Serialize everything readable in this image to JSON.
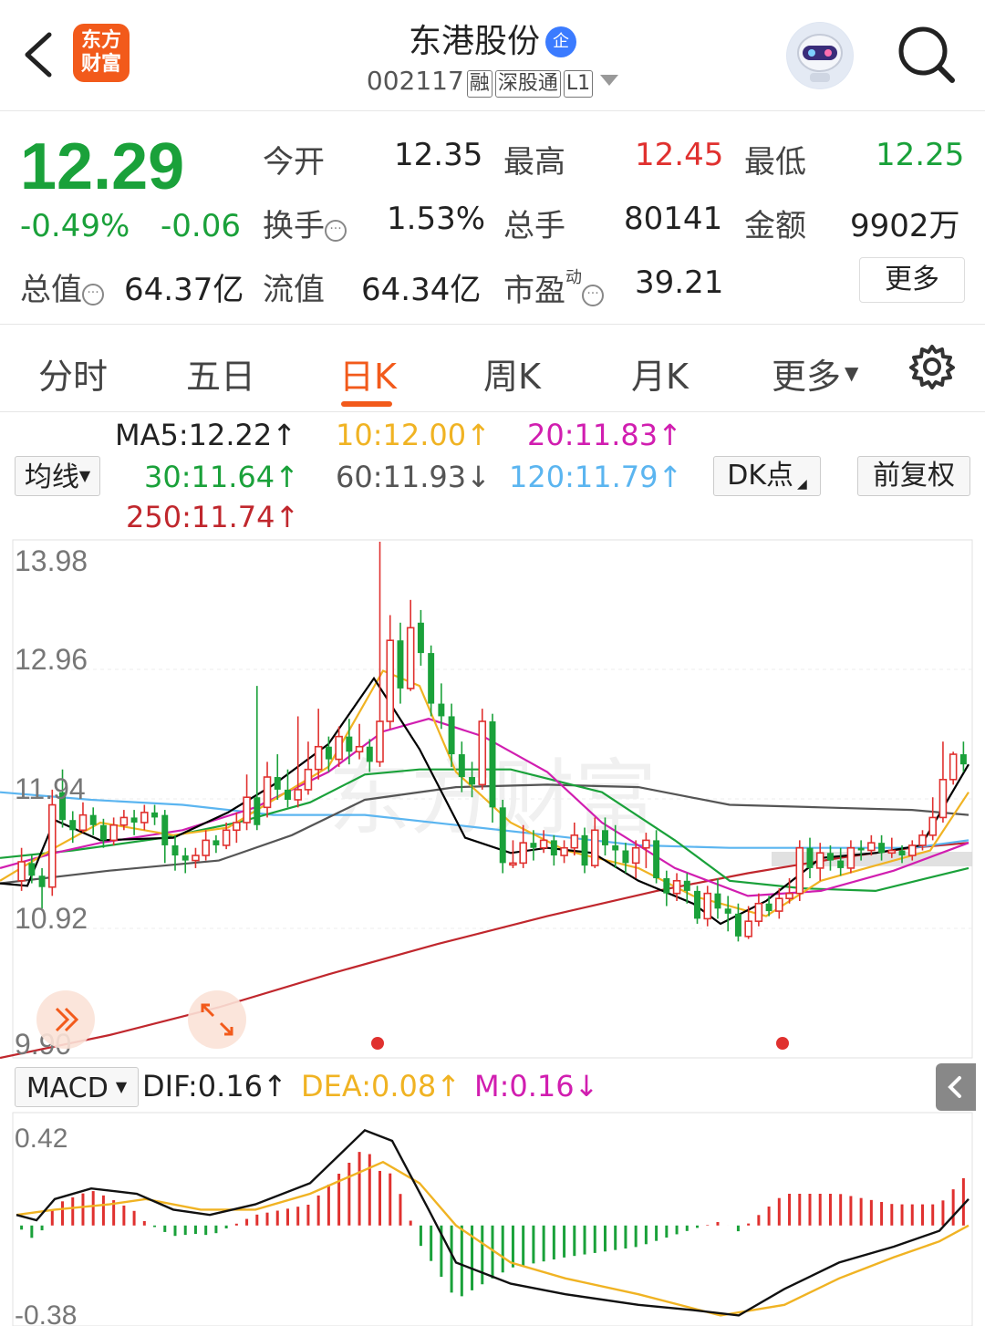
{
  "header": {
    "title": "东港股份",
    "qi_badge": "企",
    "code": "002117",
    "tags": [
      "融",
      "深股通",
      "L1"
    ],
    "logo_line1": "东方",
    "logo_line2": "财富"
  },
  "quote": {
    "price": "12.29",
    "change_pct": "-0.49%",
    "change": "-0.06",
    "open_label": "今开",
    "open": "12.35",
    "high_label": "最高",
    "high": "12.45",
    "low_label": "最低",
    "low": "12.25",
    "turnover_label": "换手",
    "turnover": "1.53%",
    "volume_label": "总手",
    "volume": "80141",
    "amount_label": "金额",
    "amount": "9902万",
    "mktcap_label": "总值",
    "mktcap": "64.37亿",
    "float_label": "流值",
    "float_cap": "64.34亿",
    "pe_label": "市盈",
    "pe_sup": "动",
    "pe": "39.21",
    "more": "更多"
  },
  "tabs": [
    "分时",
    "五日",
    "日K",
    "周K",
    "月K",
    "更多"
  ],
  "ma": {
    "selector": "均线",
    "ma5": "MA5:12.22↑",
    "ma10": "10:12.00↑",
    "ma20": "20:11.83↑",
    "ma30": "30:11.64↑",
    "ma60": "60:11.93↓",
    "ma120": "120:11.79↑",
    "ma250": "250:11.74↑",
    "dk": "DK点",
    "adjust": "前复权"
  },
  "macd": {
    "selector": "MACD",
    "dif": "DIF:0.16↑",
    "dea": "DEA:0.08↑",
    "m": "M:0.16↓",
    "axis_top": "0.42",
    "axis_bottom": "-0.38"
  },
  "chart_data": {
    "type": "candlestick",
    "y_axis_labels": [
      "13.98",
      "12.96",
      "11.94",
      "10.92",
      "9.90"
    ],
    "ylim": [
      9.9,
      13.98
    ],
    "colors": {
      "up": "#e0312f",
      "down": "#1aa13a",
      "ma5": "#000000",
      "ma10": "#f0b323",
      "ma20": "#d11eb0",
      "ma30": "#1aa13a",
      "ma60": "#555555",
      "ma120": "#5bb5f0",
      "ma250": "#c0272d"
    },
    "candles": [
      [
        11.3,
        11.45,
        11.56,
        11.22
      ],
      [
        11.44,
        11.34,
        11.5,
        11.28
      ],
      [
        11.34,
        11.25,
        11.4,
        11.08
      ],
      [
        11.25,
        11.9,
        12.02,
        11.18
      ],
      [
        12.0,
        11.78,
        12.18,
        11.72
      ],
      [
        11.78,
        11.7,
        11.85,
        11.6
      ],
      [
        11.7,
        11.82,
        11.92,
        11.68
      ],
      [
        11.82,
        11.74,
        11.88,
        11.66
      ],
      [
        11.74,
        11.62,
        11.79,
        11.56
      ],
      [
        11.62,
        11.74,
        11.8,
        11.58
      ],
      [
        11.74,
        11.8,
        11.86,
        11.7
      ],
      [
        11.8,
        11.76,
        11.86,
        11.66
      ],
      [
        11.76,
        11.84,
        11.9,
        11.7
      ],
      [
        11.84,
        11.8,
        11.9,
        11.74
      ],
      [
        11.82,
        11.58,
        11.86,
        11.44
      ],
      [
        11.58,
        11.5,
        11.66,
        11.38
      ],
      [
        11.5,
        11.46,
        11.56,
        11.36
      ],
      [
        11.46,
        11.5,
        11.56,
        11.4
      ],
      [
        11.5,
        11.62,
        11.7,
        11.46
      ],
      [
        11.62,
        11.58,
        11.66,
        11.52
      ],
      [
        11.58,
        11.7,
        11.76,
        11.55
      ],
      [
        11.7,
        11.76,
        11.84,
        11.6
      ],
      [
        11.76,
        11.96,
        12.14,
        11.7
      ],
      [
        11.96,
        11.74,
        12.84,
        11.7
      ],
      [
        11.88,
        12.12,
        12.24,
        11.8
      ],
      [
        12.12,
        12.02,
        12.3,
        11.94
      ],
      [
        12.02,
        11.94,
        12.18,
        11.88
      ],
      [
        11.94,
        12.02,
        12.6,
        11.88
      ],
      [
        12.02,
        12.18,
        12.4,
        11.98
      ],
      [
        12.18,
        12.36,
        12.66,
        12.1
      ],
      [
        12.36,
        12.26,
        12.44,
        12.16
      ],
      [
        12.26,
        12.44,
        12.52,
        12.2
      ],
      [
        12.44,
        12.32,
        12.58,
        12.22
      ],
      [
        12.32,
        12.36,
        12.54,
        12.26
      ],
      [
        12.36,
        12.24,
        12.42,
        12.16
      ],
      [
        12.24,
        12.56,
        13.98,
        12.2
      ],
      [
        12.56,
        13.2,
        13.4,
        12.5
      ],
      [
        13.2,
        12.82,
        13.34,
        12.7
      ],
      [
        12.82,
        13.3,
        13.52,
        12.8
      ],
      [
        13.34,
        13.1,
        13.44,
        13.0
      ],
      [
        13.1,
        12.7,
        13.16,
        12.6
      ],
      [
        12.7,
        12.6,
        12.86,
        12.5
      ],
      [
        12.6,
        12.3,
        12.7,
        12.2
      ],
      [
        12.3,
        12.12,
        12.4,
        12.0
      ],
      [
        12.12,
        12.06,
        12.24,
        11.96
      ],
      [
        12.06,
        12.56,
        12.66,
        12.02
      ],
      [
        12.56,
        11.88,
        12.62,
        11.76
      ],
      [
        11.88,
        11.44,
        11.94,
        11.36
      ],
      [
        11.44,
        11.44,
        11.62,
        11.4
      ],
      [
        11.44,
        11.6,
        11.74,
        11.4
      ],
      [
        11.6,
        11.56,
        11.7,
        11.46
      ],
      [
        11.56,
        11.62,
        11.7,
        11.52
      ],
      [
        11.62,
        11.5,
        11.66,
        11.42
      ],
      [
        11.5,
        11.56,
        11.62,
        11.44
      ],
      [
        11.56,
        11.66,
        11.76,
        11.5
      ],
      [
        11.66,
        11.42,
        11.72,
        11.36
      ],
      [
        11.42,
        11.7,
        11.8,
        11.4
      ],
      [
        11.7,
        11.58,
        11.8,
        11.5
      ],
      [
        11.58,
        11.54,
        11.74,
        11.4
      ],
      [
        11.54,
        11.44,
        11.6,
        11.36
      ],
      [
        11.44,
        11.56,
        11.62,
        11.32
      ],
      [
        11.56,
        11.62,
        11.68,
        11.4
      ],
      [
        11.62,
        11.32,
        11.7,
        11.28
      ],
      [
        11.32,
        11.2,
        11.38,
        11.1
      ],
      [
        11.2,
        11.3,
        11.36,
        11.14
      ],
      [
        11.3,
        11.22,
        11.36,
        11.12
      ],
      [
        11.22,
        11.0,
        11.26,
        10.96
      ],
      [
        11.0,
        11.2,
        11.26,
        10.94
      ],
      [
        11.2,
        11.08,
        11.32,
        11.0
      ],
      [
        11.08,
        11.04,
        11.18,
        10.9
      ],
      [
        11.04,
        10.86,
        11.12,
        10.82
      ],
      [
        10.86,
        10.98,
        11.1,
        10.84
      ],
      [
        10.98,
        11.12,
        11.2,
        10.94
      ],
      [
        11.12,
        11.06,
        11.18,
        11.02
      ],
      [
        11.06,
        11.16,
        11.24,
        11.0
      ],
      [
        11.16,
        11.2,
        11.32,
        11.12
      ],
      [
        11.2,
        11.56,
        11.62,
        11.14
      ],
      [
        11.56,
        11.4,
        11.64,
        11.32
      ],
      [
        11.4,
        11.52,
        11.6,
        11.3
      ],
      [
        11.52,
        11.46,
        11.58,
        11.38
      ],
      [
        11.46,
        11.4,
        11.56,
        11.34
      ],
      [
        11.4,
        11.56,
        11.62,
        11.36
      ],
      [
        11.56,
        11.54,
        11.62,
        11.46
      ],
      [
        11.54,
        11.6,
        11.66,
        11.5
      ],
      [
        11.6,
        11.52,
        11.66,
        11.46
      ],
      [
        11.52,
        11.54,
        11.64,
        11.48
      ],
      [
        11.54,
        11.5,
        11.58,
        11.44
      ],
      [
        11.5,
        11.58,
        11.62,
        11.46
      ],
      [
        11.58,
        11.66,
        11.7,
        11.54
      ],
      [
        11.66,
        11.8,
        11.96,
        11.62
      ],
      [
        11.8,
        12.1,
        12.4,
        11.76
      ],
      [
        12.1,
        12.3,
        12.32,
        12.06
      ],
      [
        12.3,
        12.22,
        12.4,
        12.16
      ]
    ],
    "lines": {
      "ma5": [
        [
          0,
          11.28
        ],
        [
          30,
          11.26
        ],
        [
          60,
          11.78
        ],
        [
          110,
          11.62
        ],
        [
          190,
          11.64
        ],
        [
          250,
          11.84
        ],
        [
          300,
          12.06
        ],
        [
          360,
          12.38
        ],
        [
          410,
          12.9
        ],
        [
          460,
          12.34
        ],
        [
          510,
          11.64
        ],
        [
          560,
          11.52
        ],
        [
          600,
          11.56
        ],
        [
          650,
          11.52
        ],
        [
          700,
          11.3
        ],
        [
          760,
          11.12
        ],
        [
          790,
          10.96
        ],
        [
          840,
          11.14
        ],
        [
          900,
          11.48
        ],
        [
          960,
          11.52
        ],
        [
          1010,
          11.58
        ],
        [
          1062,
          12.22
        ]
      ],
      "ma10": [
        [
          0,
          11.3
        ],
        [
          60,
          11.56
        ],
        [
          110,
          11.76
        ],
        [
          190,
          11.66
        ],
        [
          250,
          11.72
        ],
        [
          300,
          11.94
        ],
        [
          360,
          12.2
        ],
        [
          420,
          12.96
        ],
        [
          460,
          12.84
        ],
        [
          500,
          12.16
        ],
        [
          560,
          11.76
        ],
        [
          620,
          11.54
        ],
        [
          700,
          11.4
        ],
        [
          760,
          11.18
        ],
        [
          840,
          11.02
        ],
        [
          900,
          11.3
        ],
        [
          960,
          11.42
        ],
        [
          1020,
          11.54
        ],
        [
          1062,
          12.0
        ]
      ],
      "ma20": [
        [
          0,
          11.4
        ],
        [
          60,
          11.52
        ],
        [
          110,
          11.6
        ],
        [
          200,
          11.7
        ],
        [
          280,
          11.88
        ],
        [
          360,
          12.16
        ],
        [
          420,
          12.48
        ],
        [
          470,
          12.58
        ],
        [
          530,
          12.44
        ],
        [
          600,
          12.16
        ],
        [
          660,
          11.76
        ],
        [
          740,
          11.4
        ],
        [
          820,
          11.18
        ],
        [
          900,
          11.22
        ],
        [
          980,
          11.38
        ],
        [
          1062,
          11.6
        ]
      ],
      "ma30": [
        [
          0,
          11.48
        ],
        [
          80,
          11.54
        ],
        [
          180,
          11.64
        ],
        [
          260,
          11.76
        ],
        [
          340,
          11.92
        ],
        [
          400,
          12.14
        ],
        [
          460,
          12.18
        ],
        [
          560,
          12.18
        ],
        [
          660,
          12.0
        ],
        [
          740,
          11.62
        ],
        [
          800,
          11.3
        ],
        [
          880,
          11.24
        ],
        [
          960,
          11.22
        ],
        [
          1062,
          11.4
        ]
      ],
      "ma60": [
        [
          0,
          11.28
        ],
        [
          120,
          11.38
        ],
        [
          240,
          11.46
        ],
        [
          320,
          11.66
        ],
        [
          400,
          11.94
        ],
        [
          500,
          12.04
        ],
        [
          600,
          12.06
        ],
        [
          700,
          12.04
        ],
        [
          800,
          11.9
        ],
        [
          900,
          11.88
        ],
        [
          1000,
          11.86
        ],
        [
          1062,
          11.82
        ]
      ],
      "ma120": [
        [
          0,
          12.0
        ],
        [
          100,
          11.94
        ],
        [
          200,
          11.9
        ],
        [
          300,
          11.82
        ],
        [
          400,
          11.82
        ],
        [
          500,
          11.74
        ],
        [
          600,
          11.66
        ],
        [
          700,
          11.58
        ],
        [
          800,
          11.56
        ],
        [
          900,
          11.56
        ],
        [
          1000,
          11.56
        ],
        [
          1062,
          11.62
        ]
      ],
      "ma250": [
        [
          0,
          9.9
        ],
        [
          120,
          10.08
        ],
        [
          240,
          10.3
        ],
        [
          360,
          10.56
        ],
        [
          480,
          10.8
        ],
        [
          600,
          11.02
        ],
        [
          720,
          11.22
        ],
        [
          820,
          11.36
        ],
        [
          920,
          11.48
        ],
        [
          1000,
          11.56
        ],
        [
          1062,
          11.6
        ]
      ]
    },
    "macd": {
      "ylim": [
        -0.38,
        0.42
      ],
      "dif": [
        [
          18,
          0.04
        ],
        [
          40,
          0.02
        ],
        [
          60,
          0.1
        ],
        [
          100,
          0.14
        ],
        [
          150,
          0.12
        ],
        [
          190,
          0.06
        ],
        [
          230,
          0.04
        ],
        [
          280,
          0.08
        ],
        [
          340,
          0.16
        ],
        [
          400,
          0.36
        ],
        [
          430,
          0.32
        ],
        [
          470,
          0.06
        ],
        [
          500,
          -0.14
        ],
        [
          560,
          -0.22
        ],
        [
          620,
          -0.26
        ],
        [
          700,
          -0.3
        ],
        [
          760,
          -0.32
        ],
        [
          810,
          -0.34
        ],
        [
          860,
          -0.24
        ],
        [
          920,
          -0.14
        ],
        [
          980,
          -0.08
        ],
        [
          1030,
          -0.02
        ],
        [
          1062,
          0.1
        ]
      ],
      "dea": [
        [
          18,
          0.04
        ],
        [
          60,
          0.06
        ],
        [
          120,
          0.08
        ],
        [
          160,
          0.1
        ],
        [
          220,
          0.06
        ],
        [
          280,
          0.06
        ],
        [
          340,
          0.12
        ],
        [
          420,
          0.24
        ],
        [
          460,
          0.16
        ],
        [
          500,
          0.0
        ],
        [
          560,
          -0.14
        ],
        [
          620,
          -0.2
        ],
        [
          700,
          -0.26
        ],
        [
          790,
          -0.34
        ],
        [
          860,
          -0.3
        ],
        [
          920,
          -0.2
        ],
        [
          980,
          -0.12
        ],
        [
          1030,
          -0.06
        ],
        [
          1062,
          0.0
        ]
      ]
    }
  }
}
